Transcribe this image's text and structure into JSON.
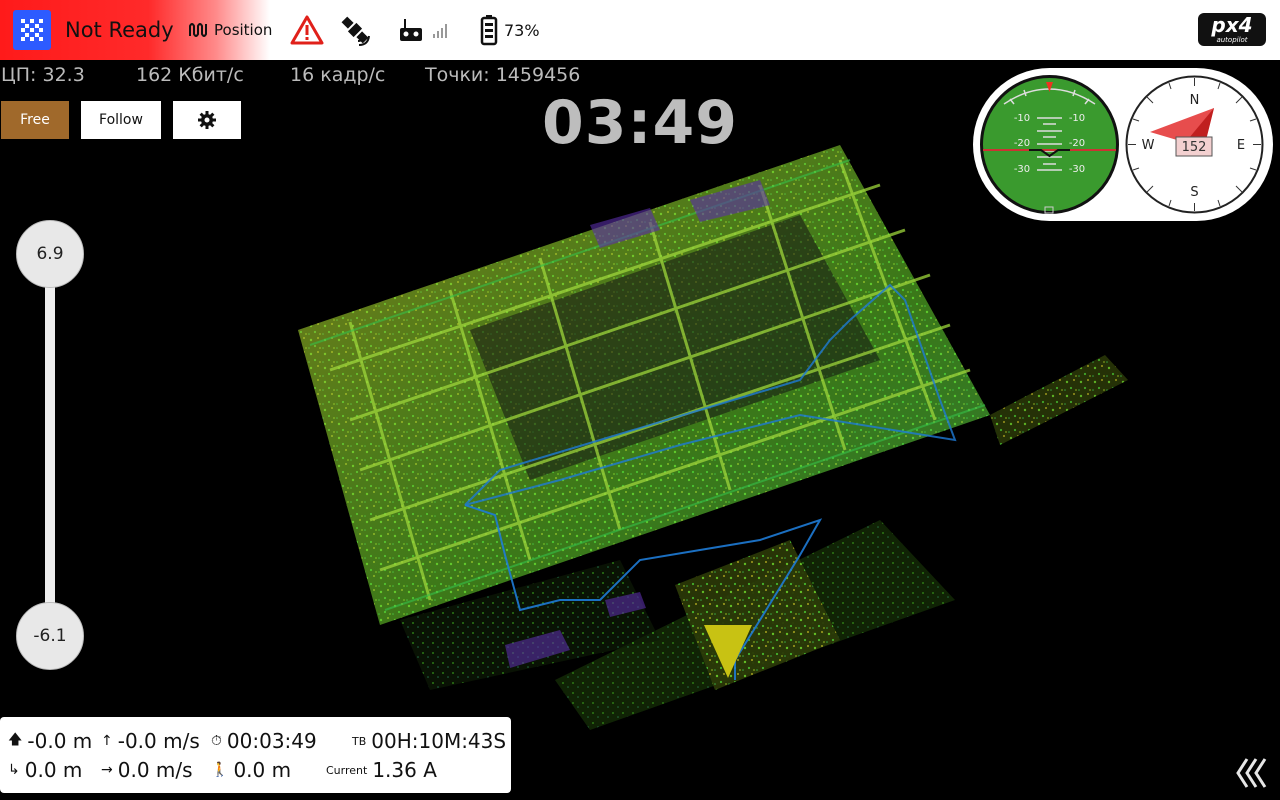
{
  "toolbar": {
    "ready_status": "Not Ready",
    "flight_mode": "Position",
    "battery_percent": "73%",
    "brand": "px4",
    "brand_sub": "autopilot",
    "icons": [
      "qgc-logo-icon",
      "signal-wave-icon",
      "warning-icon",
      "satellite-icon",
      "rc-transmitter-icon",
      "signal-bars-icon",
      "battery-icon"
    ]
  },
  "stats": {
    "cpu": "ЦП: 32.3",
    "bitrate": "162 Кбит/с",
    "fps": "16 кадр/с",
    "points": "Точки: 1459456"
  },
  "view_buttons": {
    "free": "Free",
    "follow": "Follow",
    "settings_icon": "gear-icon",
    "active": "free"
  },
  "timer": "03:49",
  "altitude_slider": {
    "top": "6.9",
    "bottom": "-6.1"
  },
  "attitude": {
    "pitch_labels_left": [
      "-10",
      "-20",
      "-30"
    ],
    "pitch_labels_right": [
      "-10",
      "-20",
      "-30"
    ]
  },
  "compass": {
    "heading": "152",
    "n": "N",
    "e": "E",
    "s": "S",
    "w": "W"
  },
  "telemetry": {
    "altitude": "-0.0 m",
    "vertical_speed": "-0.0 m/s",
    "flight_time": "00:03:49",
    "tb_label": "TB",
    "flight_time_remaining": "00H:10M:43S",
    "distance": "0.0 m",
    "horizontal_speed": "0.0 m/s",
    "distance_to_home": "0.0 m",
    "current_label": "Current",
    "current": "1.36 A"
  },
  "colors": {
    "not_ready_red": "#ff1a1a",
    "free_button": "#a0692b",
    "point_cloud_green": "#4fd12a",
    "point_cloud_yellow": "#a8a91e",
    "vehicle_marker": "#c8c213",
    "path_blue": "#1e7bd6"
  }
}
